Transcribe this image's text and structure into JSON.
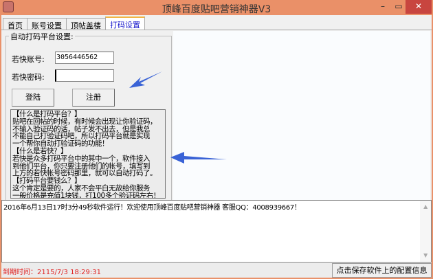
{
  "window": {
    "title": "顶峰百度贴吧营销神器V3",
    "minimize": "–",
    "maximize": "▭",
    "close": "✕"
  },
  "tabs": [
    {
      "label": "首页"
    },
    {
      "label": "账号设置"
    },
    {
      "label": "顶帖盖楼"
    },
    {
      "label": "打码设置"
    }
  ],
  "group": {
    "label": "自动打码平台设置:",
    "account_label": "若快账号:",
    "account_value": "3056446562",
    "password_label": "若快密码:",
    "password_value": "",
    "login_button": "登陆",
    "register_button": "注册"
  },
  "help_lines": [
    "【什么是打码平台？】",
    "贴吧在回帖的时候，有时候会出现让你验证码，",
    "不输入验证码的话，帖子发不出去，但是我总",
    "不能自己打验证码吧，所以打码平台就是实现",
    "一个帮你自动打验证码的功能！",
    "【什么是若快？】",
    "若快是众多打码平台中的其中一个，软件接入",
    "到他们平台，你只要注册他们的帐号，填写到",
    "上方的若快帐号密码那里，就可以自动打码了。",
    "【打码平台要钱么？】",
    "这个肯定是要的，人家不会平白无故给你服务",
    "一般价格是充值1块钱，打100多个验证码左右！"
  ],
  "log": {
    "text": "2016年6月13日17时3分49秒软件运行！欢迎使用顶峰百度贴吧营销神器 客服QQ：4008939667！"
  },
  "status": {
    "expire": "到期时间：2115/7/3 18:29:31",
    "save_button": "点击保存软件上的配置信息"
  },
  "colors": {
    "titlebar": "#ea9068",
    "arrow": "#3a63d6",
    "expire": "#e02020"
  }
}
